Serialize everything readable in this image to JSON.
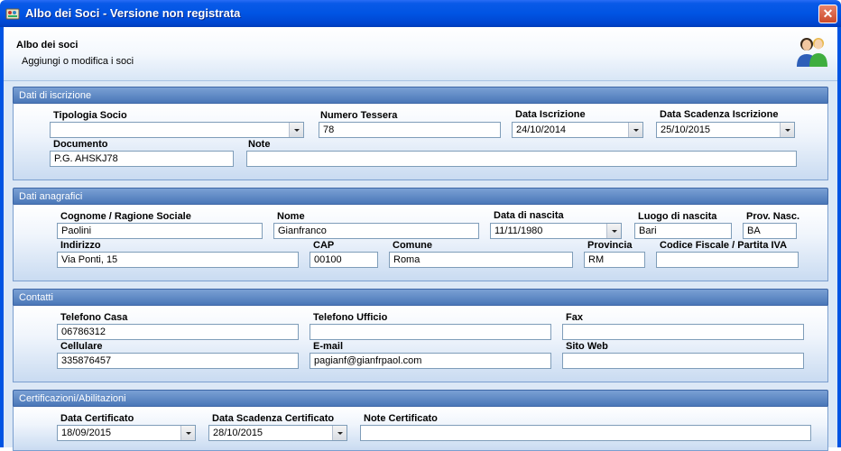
{
  "window": {
    "title": "Albo dei Soci - Versione non registrata",
    "close_symbol": "✕"
  },
  "header": {
    "title": "Albo dei soci",
    "subtitle": "Aggiungi o modifica i soci",
    "icon": "users-icon"
  },
  "iscrizione": {
    "heading": "Dati di iscrizione",
    "tipologia_label": "Tipologia Socio",
    "tipologia_value": "",
    "tessera_label": "Numero Tessera",
    "tessera_value": "78",
    "data_iscr_label": "Data Iscrizione",
    "data_iscr_value": "24/10/2014",
    "data_scad_label": "Data Scadenza Iscrizione",
    "data_scad_value": "25/10/2015",
    "documento_label": "Documento",
    "documento_value": "P.G. AHSKJ78",
    "note_label": "Note",
    "note_value": ""
  },
  "anagrafici": {
    "heading": "Dati anagrafici",
    "cognome_label": "Cognome / Ragione Sociale",
    "cognome_value": "Paolini",
    "nome_label": "Nome",
    "nome_value": "Gianfranco",
    "nascita_label": "Data di nascita",
    "nascita_value": "11/11/1980",
    "luogo_label": "Luogo di nascita",
    "luogo_value": "Bari",
    "prov_nasc_label": "Prov. Nasc.",
    "prov_nasc_value": "BA",
    "indirizzo_label": "Indirizzo",
    "indirizzo_value": "Via Ponti, 15",
    "cap_label": "CAP",
    "cap_value": "00100",
    "comune_label": "Comune",
    "comune_value": "Roma",
    "provincia_label": "Provincia",
    "provincia_value": "RM",
    "cf_label": "Codice Fiscale / Partita IVA",
    "cf_value": ""
  },
  "contatti": {
    "heading": "Contatti",
    "tel_casa_label": "Telefono Casa",
    "tel_casa_value": "06786312",
    "tel_uff_label": "Telefono Ufficio",
    "tel_uff_value": "",
    "fax_label": "Fax",
    "fax_value": "",
    "cell_label": "Cellulare",
    "cell_value": "335876457",
    "email_label": "E-mail",
    "email_value": "pagianf@gianfrpaol.com",
    "web_label": "Sito Web",
    "web_value": ""
  },
  "certificazioni": {
    "heading": "Certificazioni/Abilitazioni",
    "data_cert_label": "Data Certificato",
    "data_cert_value": "18/09/2015",
    "data_scad_cert_label": "Data Scadenza Certificato",
    "data_scad_cert_value": "28/10/2015",
    "note_cert_label": "Note Certificato",
    "note_cert_value": ""
  }
}
